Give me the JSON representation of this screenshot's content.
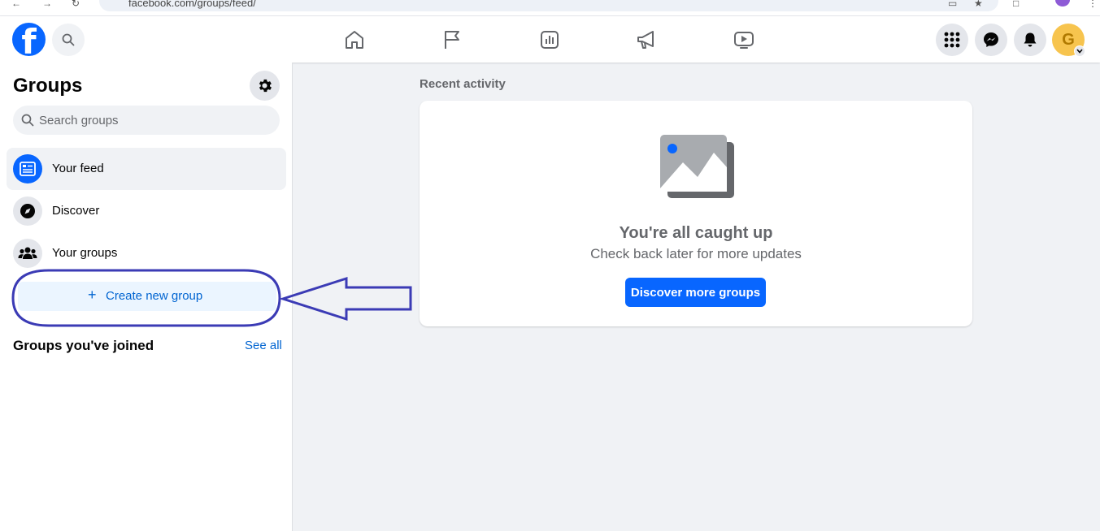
{
  "browser": {
    "url": "facebook.com/groups/feed/"
  },
  "sidebar": {
    "title": "Groups",
    "search_placeholder": "Search groups",
    "items": [
      {
        "label": "Your feed"
      },
      {
        "label": "Discover"
      },
      {
        "label": "Your groups"
      }
    ],
    "create_label": "Create new group",
    "create_plus": "+",
    "joined_title": "Groups you've joined",
    "see_all": "See all"
  },
  "main": {
    "recent_label": "Recent activity",
    "empty_title": "You're all caught up",
    "empty_subtitle": "Check back later for more updates",
    "discover_button": "Discover more groups"
  },
  "avatar": {
    "letter": "G"
  },
  "logo": {
    "letter": "f"
  },
  "colors": {
    "brand": "#0866ff",
    "link": "#0064d1",
    "annotation": "#3b3bb5"
  },
  "icons": {
    "logo": "facebook-logo-icon",
    "search": "search-icon",
    "home": "home-icon",
    "pages": "flag-icon",
    "ads": "chart-icon",
    "campaign": "megaphone-icon",
    "video": "video-icon",
    "menu": "grid-menu-icon",
    "messenger": "messenger-icon",
    "notifications": "bell-icon",
    "settings": "gear-icon",
    "feed": "feed-icon",
    "discover": "compass-icon",
    "groups": "people-icon",
    "placeholder": "image-placeholder-icon"
  }
}
